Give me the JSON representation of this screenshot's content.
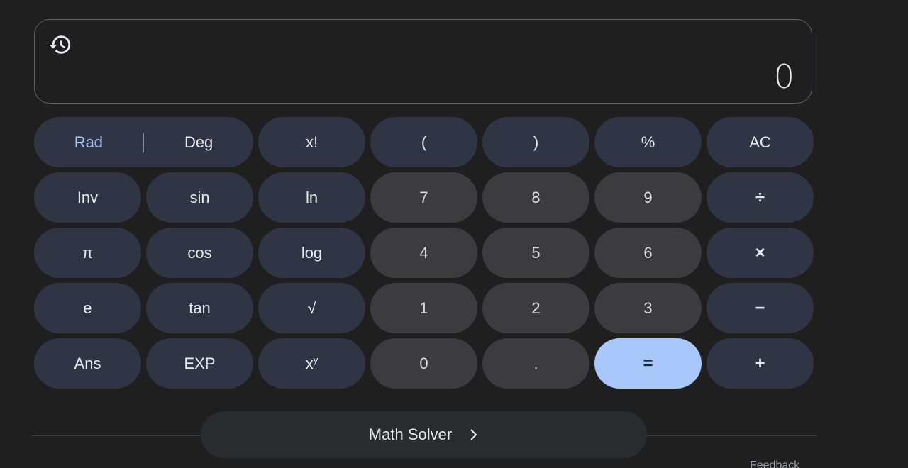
{
  "display": {
    "value": "0",
    "history_icon": "history-icon"
  },
  "mode": {
    "rad_label": "Rad",
    "deg_label": "Deg",
    "active": "Rad"
  },
  "keys": {
    "factorial": "x!",
    "open_paren": "(",
    "close_paren": ")",
    "percent": "%",
    "clear": "AC",
    "inv": "Inv",
    "sin": "sin",
    "ln": "ln",
    "seven": "7",
    "eight": "8",
    "nine": "9",
    "divide": "÷",
    "pi": "π",
    "cos": "cos",
    "log": "log",
    "four": "4",
    "five": "5",
    "six": "6",
    "multiply": "×",
    "e": "e",
    "tan": "tan",
    "sqrt": "√",
    "one": "1",
    "two": "2",
    "three": "3",
    "minus": "−",
    "ans": "Ans",
    "exp": "EXP",
    "power_base": "x",
    "power_exp": "y",
    "zero": "0",
    "decimal": ".",
    "equals": "=",
    "plus": "+"
  },
  "math_solver": {
    "label": "Math Solver",
    "icon": "chevron-right-icon"
  },
  "footer": {
    "feedback": "Feedback"
  },
  "colors": {
    "background": "#1f1f1f",
    "function_key": "#303545",
    "number_key": "#3c3c3f",
    "equals_key": "#a8c7fa",
    "accent": "#a8c7fa"
  }
}
